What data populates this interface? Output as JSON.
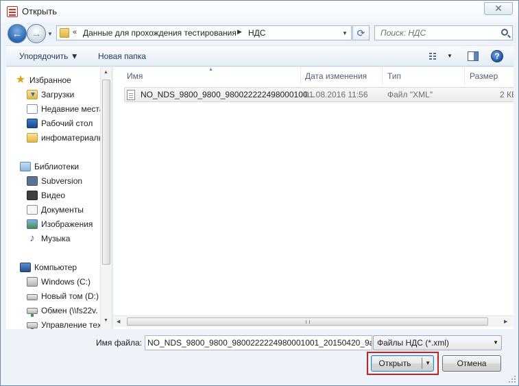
{
  "window": {
    "title": "Открыть",
    "close_symbol": "✕"
  },
  "navigation": {
    "back_icon": "back-arrow-icon",
    "forward_icon": "forward-arrow-icon",
    "address": {
      "overflow": "«",
      "segments": [
        "Данные для прохождения тестирования",
        "НДС"
      ],
      "separator": "▶"
    },
    "search": {
      "placeholder": "Поиск: НДС"
    }
  },
  "toolbar": {
    "organize_label": "Упорядочить ▼",
    "new_folder_label": "Новая папка",
    "help_label": "?"
  },
  "sidebar": {
    "favorites": {
      "label": "Избранное",
      "items": [
        {
          "label": "Загрузки",
          "icon": "downloads-folder-icon"
        },
        {
          "label": "Недавние места",
          "icon": "recent-places-icon"
        },
        {
          "label": "Рабочий стол",
          "icon": "desktop-icon"
        },
        {
          "label": "инфоматериалы",
          "icon": "folder-icon"
        }
      ]
    },
    "libraries": {
      "label": "Библиотеки",
      "items": [
        {
          "label": "Subversion",
          "icon": "subversion-library-icon"
        },
        {
          "label": "Видео",
          "icon": "video-library-icon"
        },
        {
          "label": "Документы",
          "icon": "documents-library-icon"
        },
        {
          "label": "Изображения",
          "icon": "pictures-library-icon"
        },
        {
          "label": "Музыка",
          "icon": "music-library-icon"
        }
      ]
    },
    "computer": {
      "label": "Компьютер",
      "items": [
        {
          "label": "Windows (C:)",
          "icon": "windows-drive-icon"
        },
        {
          "label": "Новый том (D:)",
          "icon": "drive-icon"
        },
        {
          "label": "Обмен (\\\\fs22v.",
          "icon": "network-drive-icon"
        },
        {
          "label": "Управление тех",
          "icon": "network-drive-icon"
        }
      ]
    }
  },
  "file_list": {
    "columns": [
      "Имя",
      "Дата изменения",
      "Тип",
      "Размер"
    ],
    "rows": [
      {
        "name": "NO_NDS_9800_9800_980022222498000100...",
        "date": "01.08.2016 11:56",
        "type": "Файл \"XML\"",
        "size": "2 КБ"
      }
    ]
  },
  "bottom": {
    "filename_label": "Имя файла:",
    "filename_value": "NO_NDS_9800_9800_9800222224980001001_20150420_9a0",
    "filter_value": "Файлы НДС (*.xml)",
    "open_label": "Открыть",
    "cancel_label": "Отмена"
  },
  "colors": {
    "accent": "#2565ad",
    "highlight_border": "#cc1d24",
    "window_bg": "#eef3f9"
  }
}
